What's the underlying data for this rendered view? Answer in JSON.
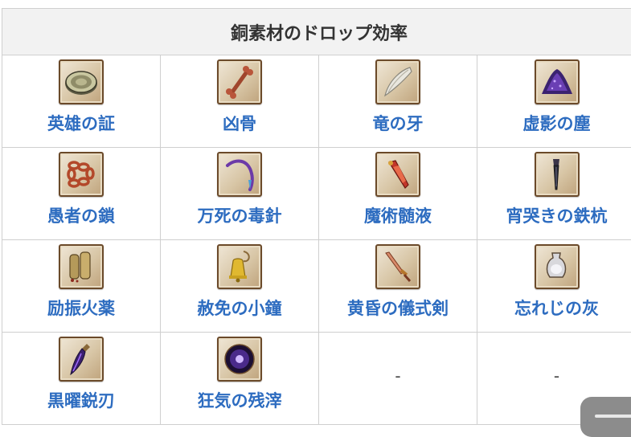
{
  "table": {
    "title": "銅素材のドロップ効率",
    "items": [
      {
        "name": "英雄の証",
        "icon": "medal-icon"
      },
      {
        "name": "凶骨",
        "icon": "bone-icon"
      },
      {
        "name": "竜の牙",
        "icon": "fang-icon"
      },
      {
        "name": "虚影の塵",
        "icon": "dust-icon"
      },
      {
        "name": "愚者の鎖",
        "icon": "chain-icon"
      },
      {
        "name": "万死の毒針",
        "icon": "needle-icon"
      },
      {
        "name": "魔術髄液",
        "icon": "vial-icon"
      },
      {
        "name": "宵哭きの鉄杭",
        "icon": "stake-icon"
      },
      {
        "name": "励振火薬",
        "icon": "gunpowder-icon"
      },
      {
        "name": "赦免の小鐘",
        "icon": "bell-icon"
      },
      {
        "name": "黄昏の儀式剣",
        "icon": "dagger-icon"
      },
      {
        "name": "忘れじの灰",
        "icon": "urn-icon"
      },
      {
        "name": "黒曜鋭刃",
        "icon": "obsidian-blade-icon"
      },
      {
        "name": "狂気の残滓",
        "icon": "orb-icon"
      }
    ],
    "empty_placeholder": "-"
  },
  "widget": {
    "icon": "scroll-handle-icon"
  }
}
